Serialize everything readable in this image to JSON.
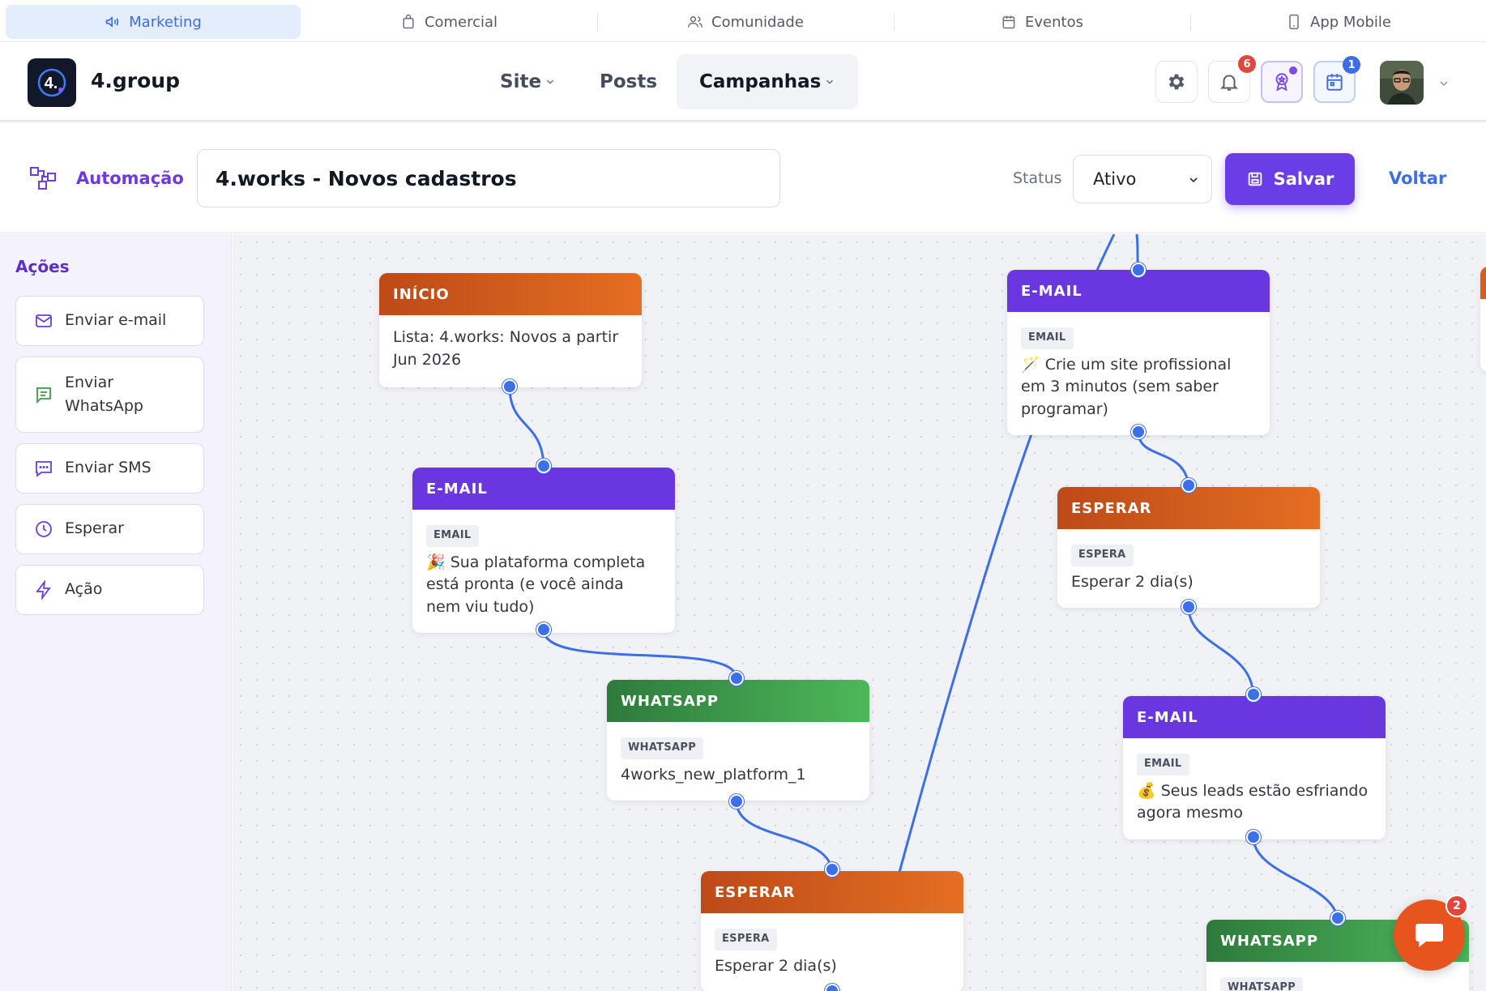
{
  "modules": [
    {
      "label": "Marketing",
      "icon": "megaphone-icon",
      "active": true
    },
    {
      "label": "Comercial",
      "icon": "shopping-bag-icon",
      "active": false
    },
    {
      "label": "Comunidade",
      "icon": "users-icon",
      "active": false
    },
    {
      "label": "Eventos",
      "icon": "calendar-icon",
      "active": false
    },
    {
      "label": "App Mobile",
      "icon": "smartphone-icon",
      "active": false
    }
  ],
  "header": {
    "logo_text": "4.",
    "brand": "4.group",
    "nav": [
      {
        "label": "Site",
        "has_dropdown": true
      },
      {
        "label": "Posts",
        "has_dropdown": false
      },
      {
        "label": "Campanhas",
        "has_dropdown": true,
        "active": true
      }
    ],
    "notifications_count": "6",
    "calendar_count": "1"
  },
  "toolbar": {
    "section_label": "Automação",
    "automation_name": "4.works - Novos cadastros",
    "status_label": "Status",
    "status_value": "Ativo",
    "save_label": "Salvar",
    "back_label": "Voltar"
  },
  "sidebar": {
    "title": "Ações",
    "items": [
      {
        "label": "Enviar e-mail",
        "icon": "mail-icon"
      },
      {
        "label": "Enviar WhatsApp",
        "icon": "message-icon"
      },
      {
        "label": "Enviar SMS",
        "icon": "sms-icon"
      },
      {
        "label": "Esperar",
        "icon": "clock-icon"
      },
      {
        "label": "Ação",
        "icon": "bolt-icon"
      }
    ]
  },
  "nodes": [
    {
      "header": "INÍCIO",
      "tag": "",
      "text": "Lista: 4.works: Novos a partir Jun 2026"
    },
    {
      "header": "E-MAIL",
      "tag": "EMAIL",
      "text": "🎉 Sua plataforma completa está pronta (e você ainda nem viu tudo)"
    },
    {
      "header": "WHATSAPP",
      "tag": "WHATSAPP",
      "text": "4works_new_platform_1"
    },
    {
      "header": "ESPERAR",
      "tag": "ESPERA",
      "text": "Esperar 2 dia(s)"
    },
    {
      "header": "E-MAIL",
      "tag": "EMAIL",
      "text": "🪄 Crie um site profissional em 3 minutos (sem saber programar)"
    },
    {
      "header": "ESPERAR",
      "tag": "ESPERA",
      "text": "Esperar 2 dia(s)"
    },
    {
      "header": "E-MAIL",
      "tag": "EMAIL",
      "text": "💰 Seus leads estão esfriando agora mesmo"
    },
    {
      "header": "WHATSAPP",
      "tag": "WHATSAPP",
      "text": ""
    }
  ],
  "chat": {
    "unread_count": "2"
  },
  "colors": {
    "accent_purple": "#6a3de6",
    "accent_blue": "#3d6ee8",
    "node_orange": "#d75c1e",
    "node_purple": "#6a36e0",
    "node_green": "#3c9a4a",
    "badge_red": "#e0463c",
    "chat_orange": "#e8541e"
  }
}
